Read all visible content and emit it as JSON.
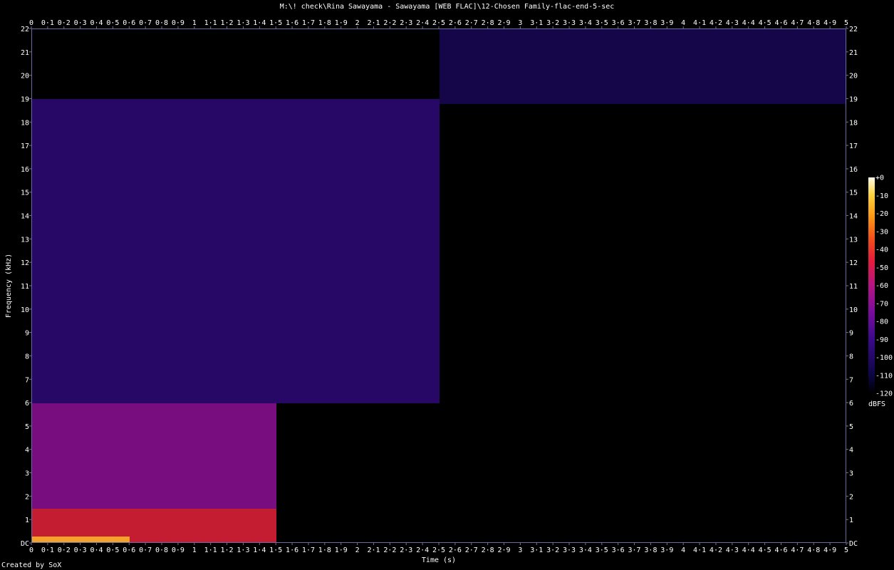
{
  "chart_data": {
    "type": "heatmap",
    "title": "M:\\! check\\Rina Sawayama - Sawayama [WEB FLAC]\\12-Chosen Family-flac-end-5-sec",
    "xlabel": "Time (s)",
    "ylabel": "Frequency (kHz)",
    "xlim": [
      0,
      5
    ],
    "ylim": [
      0,
      22
    ],
    "x_tick_labels": [
      "0",
      "0·1",
      "0·2",
      "0·3",
      "0·4",
      "0·5",
      "0·6",
      "0·7",
      "0·8",
      "0·9",
      "1",
      "1·1",
      "1·2",
      "1·3",
      "1·4",
      "1·5",
      "1·6",
      "1·7",
      "1·8",
      "1·9",
      "2",
      "2·1",
      "2·2",
      "2·3",
      "2·4",
      "2·5",
      "2·6",
      "2·7",
      "2·8",
      "2·9",
      "3",
      "3·1",
      "3·2",
      "3·3",
      "3·4",
      "3·5",
      "3·6",
      "3·7",
      "3·8",
      "3·9",
      "4",
      "4·1",
      "4·2",
      "4·3",
      "4·4",
      "4·5",
      "4·6",
      "4·7",
      "4·8",
      "4·9",
      "5"
    ],
    "y_tick_labels": [
      "DC",
      "1",
      "2",
      "3",
      "4",
      "5",
      "6",
      "7",
      "8",
      "9",
      "10",
      "11",
      "12",
      "13",
      "14",
      "15",
      "16",
      "17",
      "18",
      "19",
      "20",
      "21",
      "22"
    ],
    "colorbar": {
      "label": "dBFS",
      "range": [
        -120,
        0
      ],
      "tick_labels": [
        "+0",
        "-10",
        "-20",
        "-30",
        "-40",
        "-50",
        "-60",
        "-70",
        "-80",
        "-90",
        "-100",
        "-110",
        "-120"
      ]
    },
    "regions": [
      {
        "t": [
          0,
          0.6
        ],
        "f_khz": [
          0,
          0.3
        ],
        "level_dbfs": -15
      },
      {
        "t": [
          0,
          1.5
        ],
        "f_khz": [
          0,
          1.5
        ],
        "level_dbfs": -45
      },
      {
        "t": [
          0,
          1.5
        ],
        "f_khz": [
          1.5,
          6
        ],
        "level_dbfs": -70
      },
      {
        "t": [
          0,
          2.5
        ],
        "f_khz": [
          6,
          19
        ],
        "level_dbfs": -95
      },
      {
        "t": [
          2.5,
          5
        ],
        "f_khz": [
          0,
          18.8
        ],
        "level_dbfs": -120
      },
      {
        "t": [
          2.5,
          5
        ],
        "f_khz": [
          18.8,
          22
        ],
        "level_dbfs": -105
      }
    ]
  },
  "footer": "Created by SoX"
}
